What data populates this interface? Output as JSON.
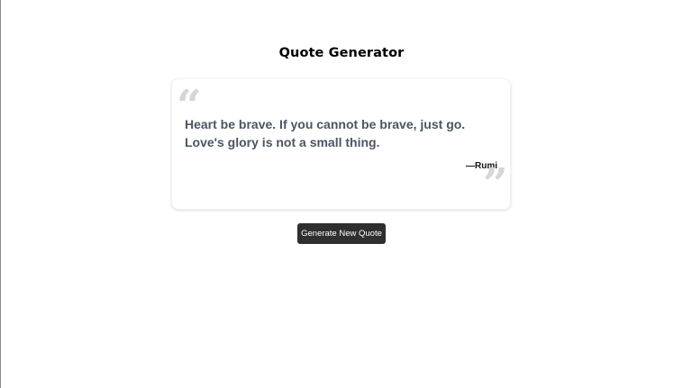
{
  "page": {
    "title": "Quote Generator"
  },
  "quote": {
    "text": "Heart be brave. If you cannot be brave, just go. Love's glory is not a small thing.",
    "author": "—Rumi",
    "open_mark": "“",
    "close_mark": "”"
  },
  "actions": {
    "generate_label": "Generate New Quote"
  },
  "icons": {
    "open": "open-quote-icon",
    "close": "close-quote-icon"
  },
  "colors": {
    "button_bg": "#2f2f2f",
    "quote_text": "#4b5563",
    "quote_marks": "#d3d6dc"
  }
}
